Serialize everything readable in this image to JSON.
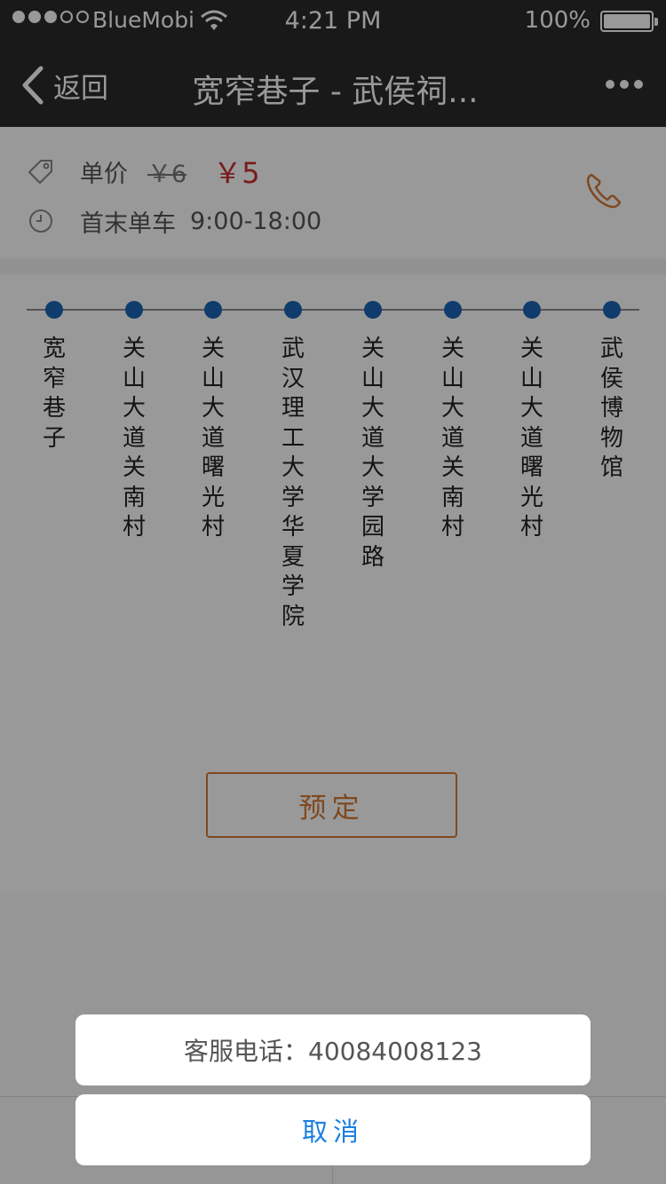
{
  "status_bar": {
    "carrier": "BlueMobi",
    "time": "4:21 PM",
    "battery": "100%"
  },
  "nav": {
    "back_label": "返回",
    "title": "宽窄巷子 - 武侯祠..."
  },
  "info": {
    "price_label": "单价",
    "price_original": "￥6",
    "price_current": "￥5",
    "schedule_label": "首末单车",
    "schedule_value": "9:00-18:00"
  },
  "route": {
    "stops": [
      "宽窄巷子",
      "关山大道关南村",
      "关山大道曙光村",
      "武汉理工大学华夏学院",
      "关山大道大学园路",
      "关山大道关南村",
      "关山大道曙光村",
      "武侯博物馆"
    ]
  },
  "book_label": "预定",
  "action_sheet": {
    "phone_text": "客服电话：40084008123",
    "cancel_label": "取消"
  },
  "colors": {
    "bar_bg": "#2a2a2a",
    "stop_dot": "#1a64b5",
    "price_red": "#c8302e",
    "accent_orange": "#d47a36",
    "cancel_blue": "#1a7ee0"
  }
}
